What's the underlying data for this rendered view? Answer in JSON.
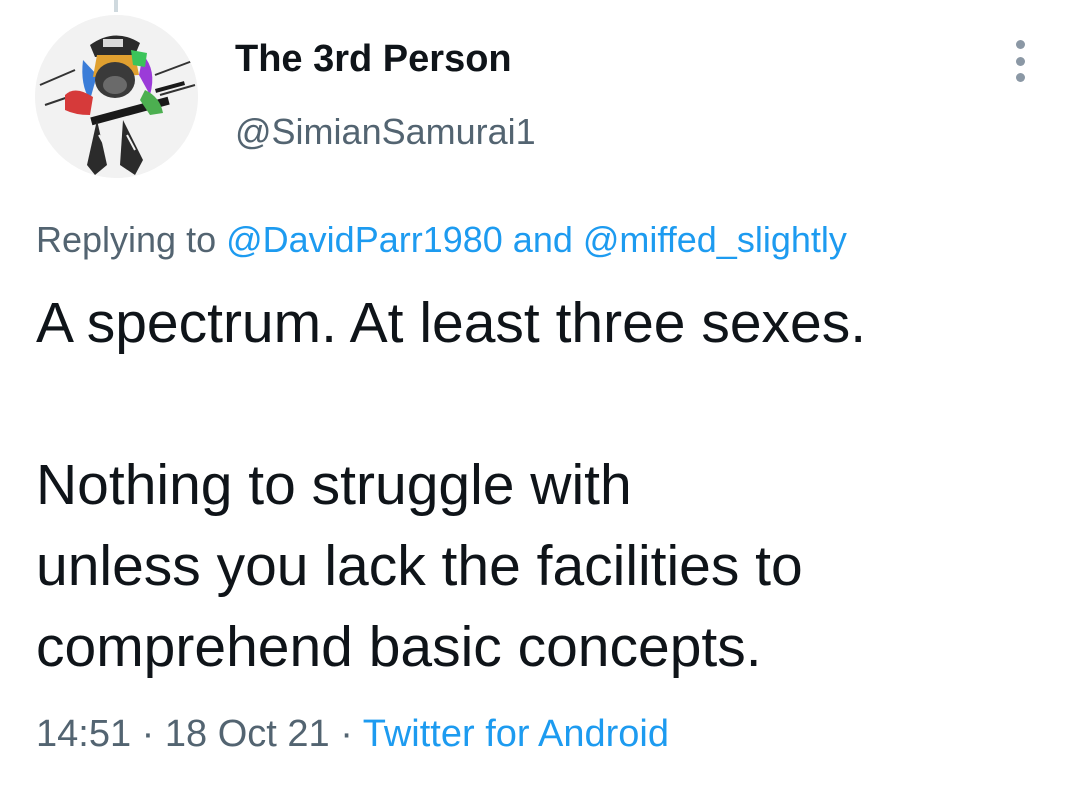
{
  "author": {
    "display_name": "The 3rd Person",
    "handle": "@SimianSamurai1",
    "avatar": "avatar-comic-gorilla-soldier"
  },
  "icons": {
    "more": "vertical-dots-icon"
  },
  "reply": {
    "prefix": "Replying to ",
    "mention_1": "@DavidParr1980",
    "separator": " and ",
    "mention_2": "@miffed_slightly"
  },
  "tweet": {
    "line_1": "A spectrum. At least three sexes.",
    "line_2": "Nothing to struggle with",
    "line_3": "unless you lack the facilities to",
    "line_4": "comprehend basic concepts."
  },
  "meta": {
    "time": "14:51",
    "dot_1": " · ",
    "date": "18 Oct 21",
    "dot_2": " · ",
    "source": "Twitter for Android"
  },
  "colors": {
    "text": "#0f1419",
    "secondary": "#536471",
    "link": "#1d9bf0"
  }
}
